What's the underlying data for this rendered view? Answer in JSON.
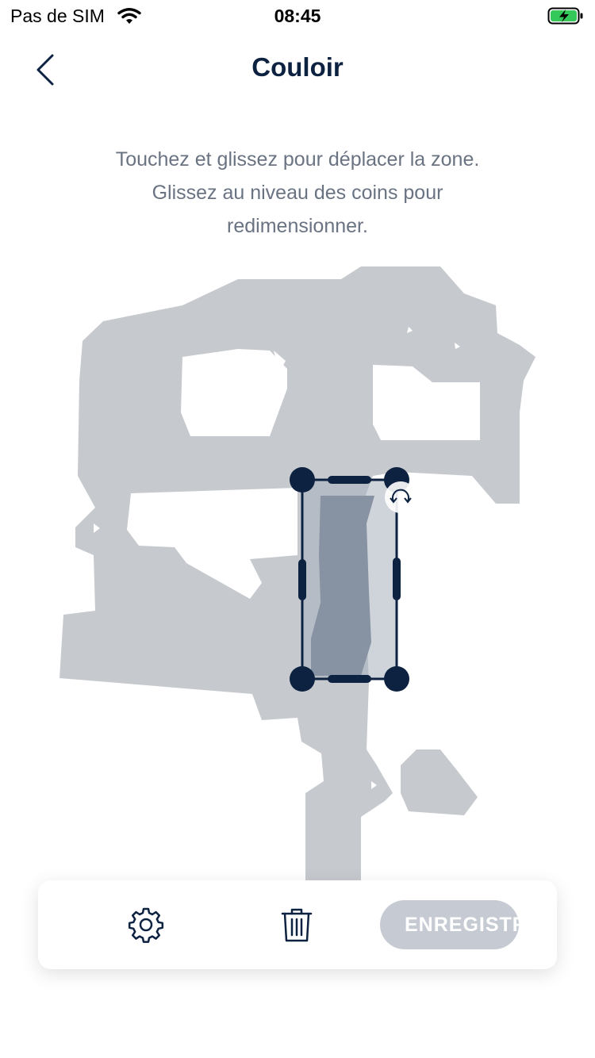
{
  "status": {
    "carrier": "Pas de SIM",
    "time": "08:45"
  },
  "nav": {
    "title": "Couloir"
  },
  "instructions": {
    "line1": "Touchez et glissez pour déplacer la zone.",
    "line2": "Glissez au niveau des coins pour",
    "line3": "redimensionner."
  },
  "toolbar": {
    "save_label": "ENREGISTRER"
  },
  "icons": {
    "back": "chevron-left-icon",
    "settings": "gear-icon",
    "delete": "trash-icon",
    "rotate": "rotate-icon"
  },
  "colors": {
    "brand": "#0d2240",
    "map": "#c6c9ce",
    "zone_fill": "#8a95a3",
    "save_disabled": "#c6cbd3"
  }
}
